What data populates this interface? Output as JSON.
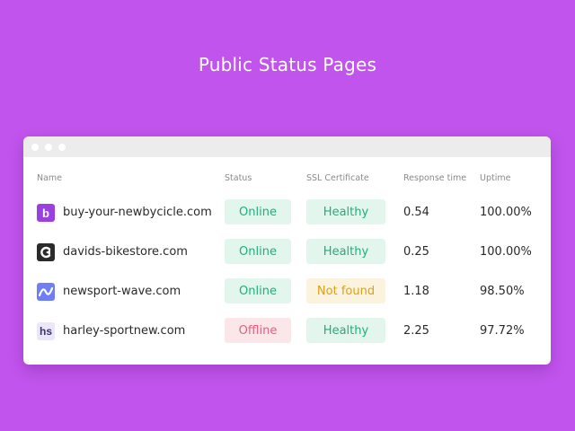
{
  "page_title": "Public Status Pages",
  "colors": {
    "background": "#c154ec",
    "online": "#1fae7e",
    "offline": "#e0627c",
    "not_found": "#d8a11b"
  },
  "table": {
    "headers": {
      "name": "Name",
      "status": "Status",
      "ssl": "SSL Certificate",
      "response": "Response time",
      "uptime": "Uptime"
    },
    "rows": [
      {
        "logo": "b",
        "logo_icon": "b-letter-icon",
        "site": "buy-your-newbycicle.com",
        "status": "Online",
        "ssl": "Healthy",
        "response": "0.54",
        "uptime": "100.00%"
      },
      {
        "logo": "",
        "logo_icon": "c-arrow-logo-icon",
        "site": "davids-bikestore.com",
        "status": "Online",
        "ssl": "Healthy",
        "response": "0.25",
        "uptime": "100.00%"
      },
      {
        "logo": "",
        "logo_icon": "wave-logo-icon",
        "site": "newsport-wave.com",
        "status": "Online",
        "ssl": "Not found",
        "response": "1.18",
        "uptime": "98.50%"
      },
      {
        "logo": "hs",
        "logo_icon": "hs-letters-icon",
        "site": "harley-sportnew.com",
        "status": "Offline",
        "ssl": "Healthy",
        "response": "2.25",
        "uptime": "97.72%"
      }
    ]
  }
}
